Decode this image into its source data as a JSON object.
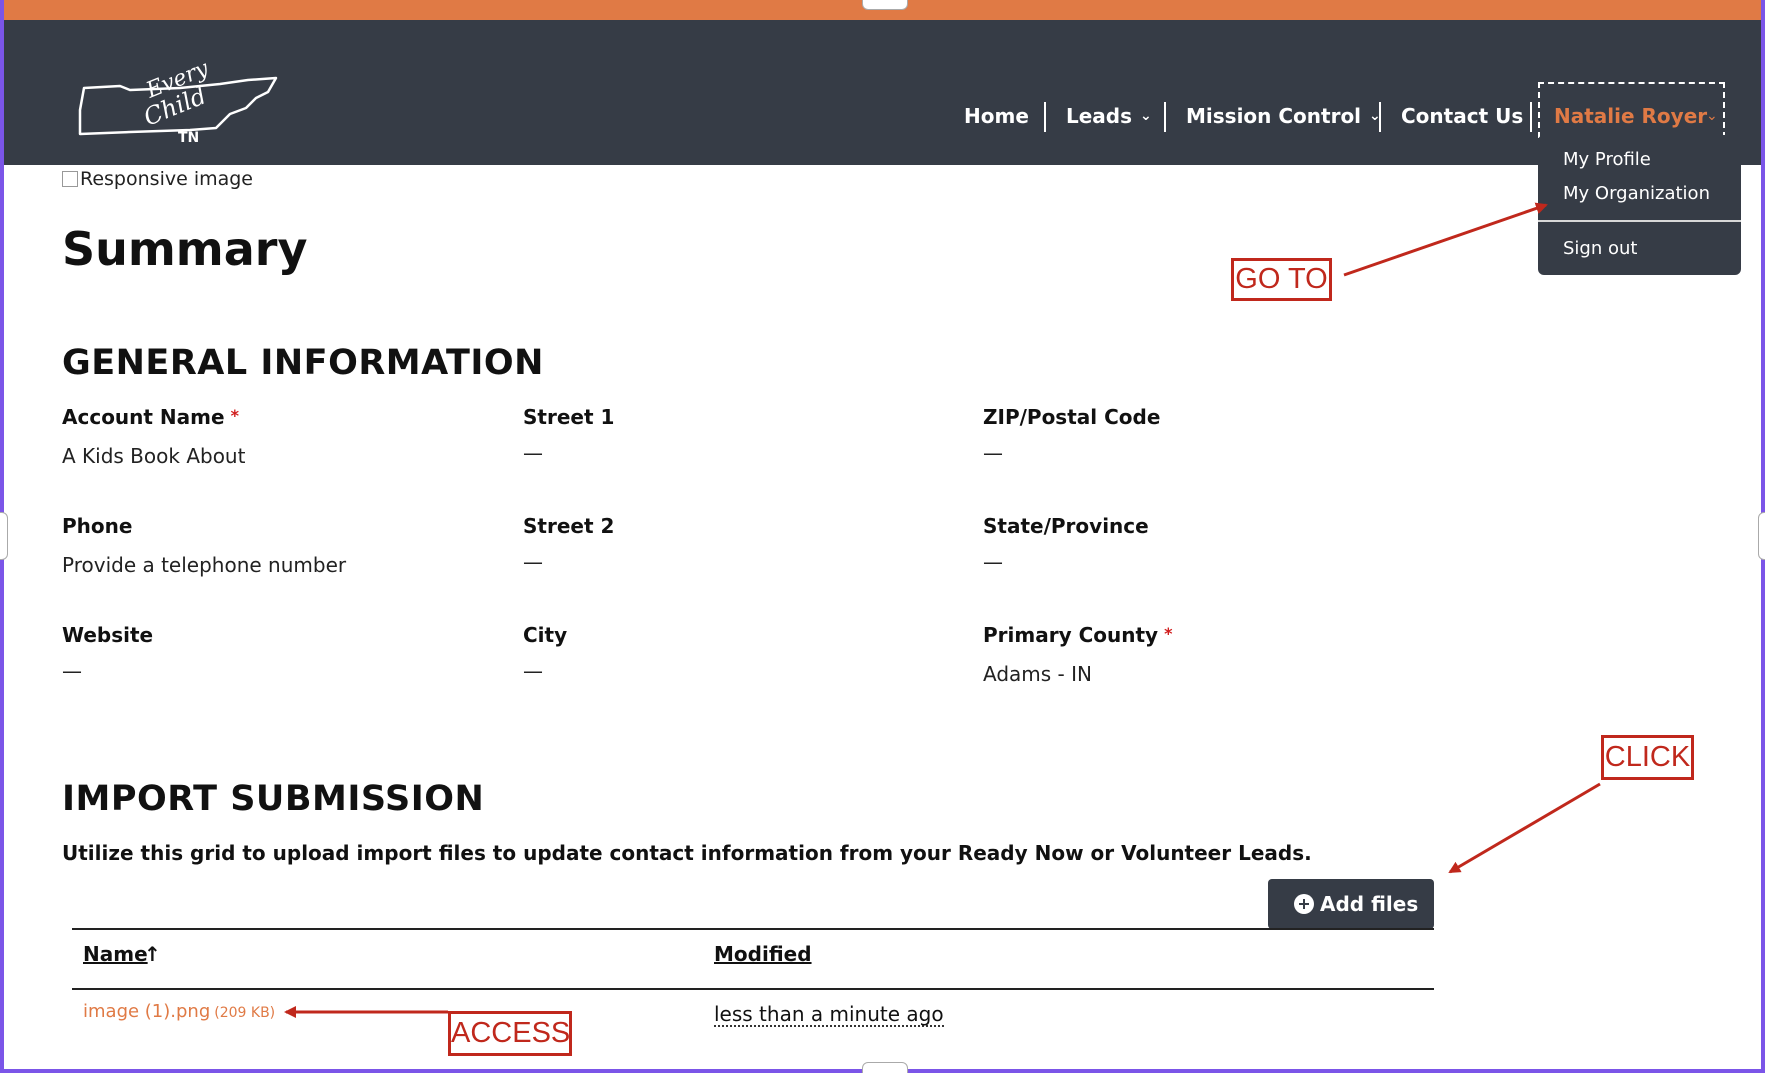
{
  "app": {
    "logo_text": "Every Child TN",
    "broken_image_alt": "Responsive image"
  },
  "nav": {
    "home": "Home",
    "leads": "Leads",
    "mission_control": "Mission Control",
    "contact_us": "Contact Us",
    "user_name": "Natalie Royer"
  },
  "user_menu": {
    "items": [
      "My Profile",
      "My Organization",
      "Sign out"
    ]
  },
  "page": {
    "title": "Summary"
  },
  "general_information": {
    "heading": "GENERAL INFORMATION",
    "fields": {
      "account_name": {
        "label": "Account Name",
        "value": "A Kids Book About",
        "required": true
      },
      "street1": {
        "label": "Street 1",
        "value": "—"
      },
      "zip": {
        "label": "ZIP/Postal Code",
        "value": "—"
      },
      "phone": {
        "label": "Phone",
        "value": "Provide a telephone number"
      },
      "street2": {
        "label": "Street 2",
        "value": "—"
      },
      "state": {
        "label": "State/Province",
        "value": "—"
      },
      "website": {
        "label": "Website",
        "value": "—"
      },
      "city": {
        "label": "City",
        "value": "—"
      },
      "primary_county": {
        "label": "Primary County",
        "value": "Adams - IN",
        "required": true
      }
    }
  },
  "import_submission": {
    "heading": "IMPORT SUBMISSION",
    "description": "Utilize this grid to upload import files to update contact information from your Ready Now or Volunteer Leads.",
    "add_button": "Add files",
    "columns": [
      "Name",
      "Modified"
    ],
    "rows": [
      {
        "name": "image (1).png",
        "size": "(209 KB)",
        "modified": "less than a minute ago"
      }
    ]
  },
  "annotations": {
    "go_to": "GO TO",
    "click": "CLICK",
    "access": "ACCESS"
  },
  "colors": {
    "header_bg": "#363c46",
    "accent": "#e07a45",
    "annotation": "#c0281c",
    "frame": "#7b55e8"
  }
}
